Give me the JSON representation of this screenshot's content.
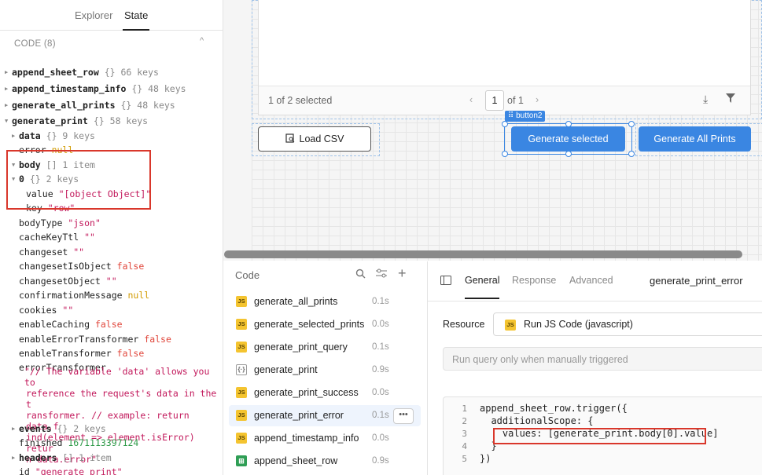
{
  "left_panel": {
    "tabs": [
      "Explorer",
      "State"
    ],
    "section_label": "CODE (8)",
    "collapse_glyph": "^",
    "tree": [
      {
        "key": "append_sheet_row",
        "meta": "{} 66 keys",
        "indent": 0,
        "bold": true,
        "tri": "right"
      },
      {
        "key": "append_timestamp_info",
        "meta": "{} 48 keys",
        "indent": 0,
        "bold": true,
        "tri": "right"
      },
      {
        "key": "generate_all_prints",
        "meta": "{} 48 keys",
        "indent": 0,
        "bold": true,
        "tri": "right"
      },
      {
        "key": "generate_print",
        "meta": "{} 58 keys",
        "indent": 0,
        "bold": true,
        "tri": "down"
      },
      {
        "key": "data",
        "meta": "{} 9 keys",
        "indent": 1,
        "bold": true,
        "tri": "right"
      },
      {
        "key": "error",
        "value": "null",
        "vtype": "nul",
        "indent": 1
      },
      {
        "key": "body",
        "meta": "[] 1 item",
        "indent": 1,
        "bold": true,
        "tri": "down"
      },
      {
        "key": "0",
        "meta": "{} 2 keys",
        "indent": 1,
        "bold": true,
        "tri": "down"
      },
      {
        "key": "value",
        "value": "\"[object Object]\"",
        "vtype": "str",
        "indent": 2
      },
      {
        "key": "key",
        "value": "\"row\"",
        "vtype": "str",
        "indent": 2
      },
      {
        "key": "bodyType",
        "value": "\"json\"",
        "vtype": "str",
        "indent": 1
      },
      {
        "key": "cacheKeyTtl",
        "value": "\"\"",
        "vtype": "str",
        "indent": 1
      },
      {
        "key": "changeset",
        "value": "\"\"",
        "vtype": "str",
        "indent": 1
      },
      {
        "key": "changesetIsObject",
        "value": "false",
        "vtype": "bool",
        "indent": 1
      },
      {
        "key": "changesetObject",
        "value": "\"\"",
        "vtype": "str",
        "indent": 1
      },
      {
        "key": "confirmationMessage",
        "value": "null",
        "vtype": "nul",
        "indent": 1
      },
      {
        "key": "cookies",
        "value": "\"\"",
        "vtype": "str",
        "indent": 1
      },
      {
        "key": "enableCaching",
        "value": "false",
        "vtype": "bool",
        "indent": 1
      },
      {
        "key": "enableErrorTransformer",
        "value": "false",
        "vtype": "bool",
        "indent": 1
      },
      {
        "key": "enableTransformer",
        "value": "false",
        "vtype": "bool",
        "indent": 1
      },
      {
        "key": "errorTransformer",
        "indent": 1
      }
    ],
    "error_transformer_lines": [
      "\"// The variable 'data' allows you to",
      "reference the request's data in the t",
      "ransformer. // example: return data.f",
      "ind(element => element.isError) retur",
      "n data.error\""
    ],
    "tree_tail": [
      {
        "key": "events",
        "meta": "{} 2 keys",
        "indent": 1,
        "bold": true,
        "tri": "right"
      },
      {
        "key": "finished",
        "value": "1671113397124",
        "vtype": "num",
        "indent": 1
      },
      {
        "key": "headers",
        "meta": "[] 1 item",
        "indent": 1,
        "bold": true,
        "tri": "right"
      },
      {
        "key": "id",
        "value": "\"generate_print\"",
        "vtype": "str",
        "indent": 1
      }
    ]
  },
  "canvas": {
    "table_footer": {
      "selection": "1 of 2 selected",
      "page": "1",
      "of_pages": "of 1"
    },
    "buttons": {
      "load_csv": "Load CSV",
      "generate_selected": "Generate selected",
      "generate_all": "Generate All Prints"
    },
    "selected_tag": "button2"
  },
  "query_list": {
    "header": "Code",
    "items": [
      {
        "name": "generate_all_prints",
        "time": "0.1s",
        "icon": "js"
      },
      {
        "name": "generate_selected_prints",
        "time": "0.0s",
        "icon": "js"
      },
      {
        "name": "generate_print_query",
        "time": "0.1s",
        "icon": "js"
      },
      {
        "name": "generate_print",
        "time": "0.9s",
        "icon": "transformer"
      },
      {
        "name": "generate_print_success",
        "time": "0.0s",
        "icon": "js"
      },
      {
        "name": "generate_print_error",
        "time": "0.1s",
        "icon": "js",
        "selected": true
      },
      {
        "name": "append_timestamp_info",
        "time": "0.0s",
        "icon": "js"
      },
      {
        "name": "append_sheet_row",
        "time": "0.9s",
        "icon": "sheets"
      }
    ],
    "more_label": "•••"
  },
  "editor": {
    "tabs": [
      "General",
      "Response",
      "Advanced"
    ],
    "query_name": "generate_print_error",
    "resource_label": "Resource",
    "resource_value": "Run JS Code (javascript)",
    "trigger_value": "Run query only when manually triggered",
    "code_lines": [
      {
        "n": "1",
        "text": "append_sheet_row.trigger({"
      },
      {
        "n": "2",
        "text": "  additionalScope: {"
      },
      {
        "n": "3",
        "text": "    values: [generate_print.body[0].value]"
      },
      {
        "n": "4",
        "text": "  }"
      },
      {
        "n": "5",
        "text": "})"
      }
    ]
  },
  "colors": {
    "accent": "#3a86e2",
    "highlight_box": "#d9372b",
    "js_icon": "#f4c430"
  }
}
